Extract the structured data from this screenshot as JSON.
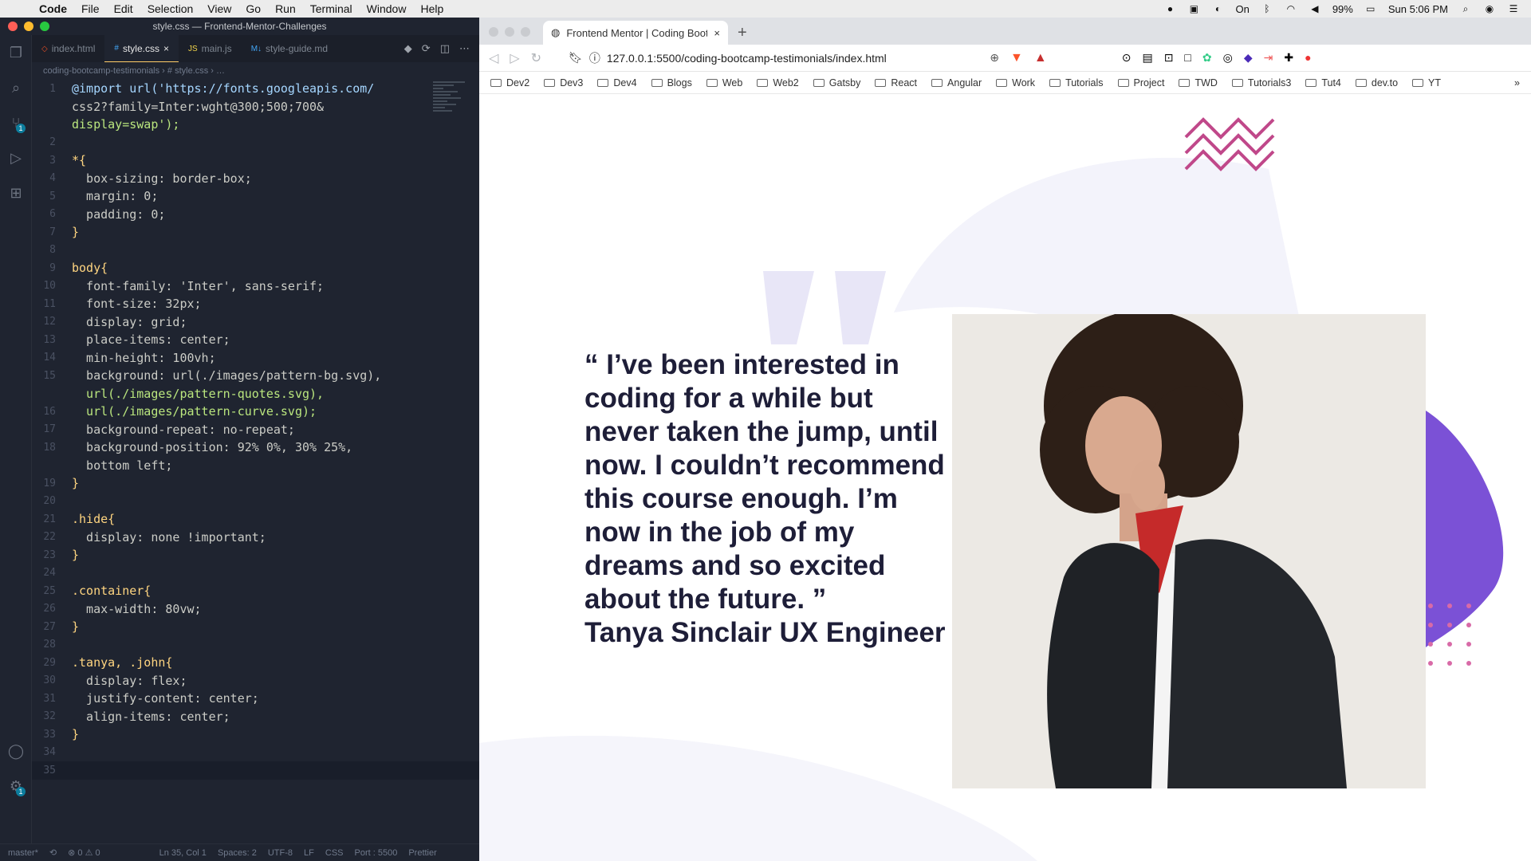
{
  "menubar": {
    "app": "Code",
    "items": [
      "File",
      "Edit",
      "Selection",
      "View",
      "Go",
      "Run",
      "Terminal",
      "Window",
      "Help"
    ],
    "battery": "99%",
    "clock": "Sun 5:06 PM",
    "focus_label": "On"
  },
  "vscode": {
    "window_title": "style.css — Frontend-Mentor-Challenges",
    "tabs": [
      {
        "label": "index.html",
        "active": false
      },
      {
        "label": "style.css",
        "active": true
      },
      {
        "label": "main.js",
        "active": false
      },
      {
        "label": "style-guide.md",
        "active": false
      }
    ],
    "badge_source_control": "1",
    "badge_settings": "1",
    "breadcrumb": "coding-bootcamp-testimonials › # style.css › …",
    "code_lines": [
      {
        "n": "1",
        "text": "@import url('https://fonts.googleapis.com/"
      },
      {
        "n": "",
        "text": "css2?family=Inter:wght@300;500;700&"
      },
      {
        "n": "",
        "text": "display=swap');"
      },
      {
        "n": "2",
        "text": ""
      },
      {
        "n": "3",
        "text": "*{"
      },
      {
        "n": "4",
        "text": "  box-sizing: border-box;"
      },
      {
        "n": "5",
        "text": "  margin: 0;"
      },
      {
        "n": "6",
        "text": "  padding: 0;"
      },
      {
        "n": "7",
        "text": "}"
      },
      {
        "n": "8",
        "text": ""
      },
      {
        "n": "9",
        "text": "body{"
      },
      {
        "n": "10",
        "text": "  font-family: 'Inter', sans-serif;"
      },
      {
        "n": "11",
        "text": "  font-size: 32px;"
      },
      {
        "n": "12",
        "text": "  display: grid;"
      },
      {
        "n": "13",
        "text": "  place-items: center;"
      },
      {
        "n": "14",
        "text": "  min-height: 100vh;"
      },
      {
        "n": "15",
        "text": "  background: url(./images/pattern-bg.svg),"
      },
      {
        "n": "",
        "text": "  url(./images/pattern-quotes.svg),"
      },
      {
        "n": "16",
        "text": "  url(./images/pattern-curve.svg);"
      },
      {
        "n": "17",
        "text": "  background-repeat: no-repeat;"
      },
      {
        "n": "18",
        "text": "  background-position: 92% 0%, 30% 25%,"
      },
      {
        "n": "",
        "text": "  bottom left;"
      },
      {
        "n": "19",
        "text": "}"
      },
      {
        "n": "20",
        "text": ""
      },
      {
        "n": "21",
        "text": ".hide{"
      },
      {
        "n": "22",
        "text": "  display: none !important;"
      },
      {
        "n": "23",
        "text": "}"
      },
      {
        "n": "24",
        "text": ""
      },
      {
        "n": "25",
        "text": ".container{"
      },
      {
        "n": "26",
        "text": "  max-width: 80vw;"
      },
      {
        "n": "27",
        "text": "}"
      },
      {
        "n": "28",
        "text": ""
      },
      {
        "n": "29",
        "text": ".tanya, .john{"
      },
      {
        "n": "30",
        "text": "  display: flex;"
      },
      {
        "n": "31",
        "text": "  justify-content: center;"
      },
      {
        "n": "32",
        "text": "  align-items: center;"
      },
      {
        "n": "33",
        "text": "}"
      },
      {
        "n": "34",
        "text": ""
      },
      {
        "n": "35",
        "text": ""
      }
    ],
    "status": {
      "branch": "master*",
      "problems": "⊗ 0 ⚠ 0",
      "position": "Ln 35, Col 1",
      "spaces": "Spaces: 2",
      "encoding": "UTF-8",
      "eol": "LF",
      "language": "CSS",
      "port": "Port : 5500",
      "formatter": "Prettier"
    }
  },
  "browser": {
    "tab_title": "Frontend Mentor | Coding Bootc",
    "url": "127.0.0.1:5500/coding-bootcamp-testimonials/index.html",
    "bookmarks": [
      "Dev2",
      "Dev3",
      "Dev4",
      "Blogs",
      "Web",
      "Web2",
      "Gatsby",
      "React",
      "Angular",
      "Work",
      "Tutorials",
      "Project",
      "TWD",
      "Tutorials3",
      "Tut4",
      "dev.to",
      "YT"
    ],
    "bookmarks_more": "»"
  },
  "testimonial": {
    "quote": "“ I’ve been interested in coding for a while but never taken the jump, until now. I couldn’t recommend this course enough. I’m now in the job of my dreams and so excited about the future. ”",
    "author": "Tanya Sinclair UX Engineer"
  },
  "colors": {
    "accent_purple": "#6a46c6",
    "pattern_pink": "#c0488a",
    "quote_mark": "#e8e6f7",
    "curve": "#f3f3fb",
    "text_dark": "#1e1e38"
  }
}
